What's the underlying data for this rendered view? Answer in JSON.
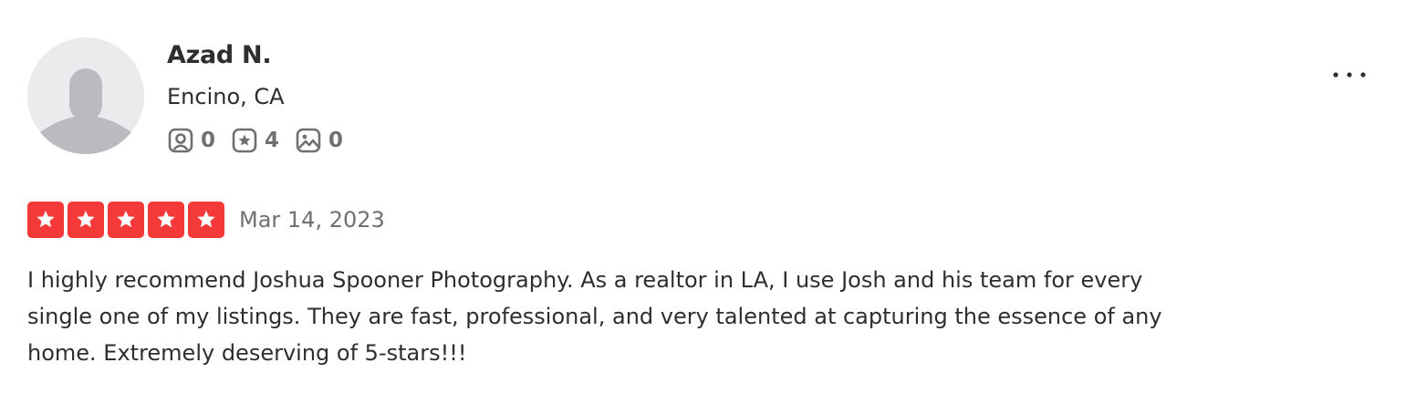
{
  "reviewer": {
    "name": "Azad N.",
    "location": "Encino, CA",
    "stats": [
      {
        "icon": "friends-icon",
        "value": "0"
      },
      {
        "icon": "reviews-icon",
        "value": "4"
      },
      {
        "icon": "photos-icon",
        "value": "0"
      }
    ]
  },
  "review": {
    "rating": 5,
    "max_rating": 5,
    "date": "Mar 14, 2023",
    "text": "I highly recommend Joshua Spooner Photography. As a realtor in LA, I use Josh and his team for every single one of my listings. They are fast, professional, and very talented at capturing the essence of any home. Extremely deserving of 5-stars!!!"
  },
  "colors": {
    "star_fill": "#f43939",
    "star_empty": "#e6e6e6",
    "text_primary": "#2d2e2f",
    "text_secondary": "#6e7072",
    "avatar_bg": "#ebebed",
    "avatar_figure": "#babbbf"
  }
}
